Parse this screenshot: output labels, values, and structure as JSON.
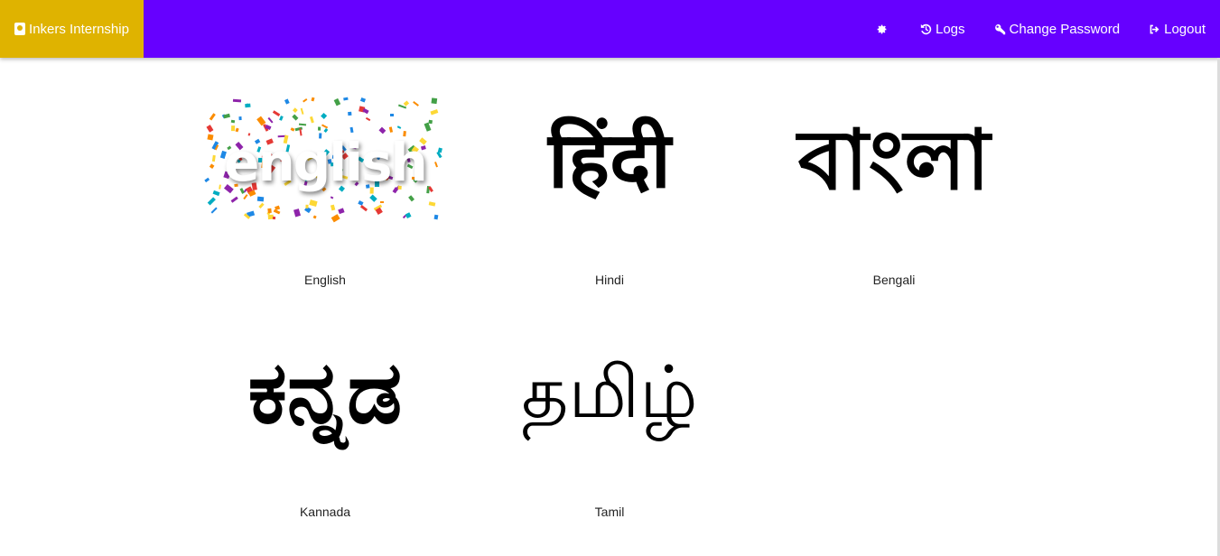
{
  "navbar": {
    "brand": "Inkers Internship",
    "items": [
      {
        "id": "settings",
        "label": "",
        "icon": "gear-icon"
      },
      {
        "id": "logs",
        "label": "Logs",
        "icon": "history-icon"
      },
      {
        "id": "change_password",
        "label": "Change Password",
        "icon": "key-icon"
      },
      {
        "id": "logout",
        "label": "Logout",
        "icon": "sign-out-icon"
      }
    ],
    "colors": {
      "bar": "#6600ff",
      "brand": "#dfb300"
    }
  },
  "languages": [
    {
      "label": "English",
      "art_text": "english"
    },
    {
      "label": "Hindi",
      "art_text": "हिंदी"
    },
    {
      "label": "Bengali",
      "art_text": "বাংলা"
    },
    {
      "label": "Kannada",
      "art_text": "ಕನ್ನಡ"
    },
    {
      "label": "Tamil",
      "art_text": "தமிழ்"
    }
  ]
}
